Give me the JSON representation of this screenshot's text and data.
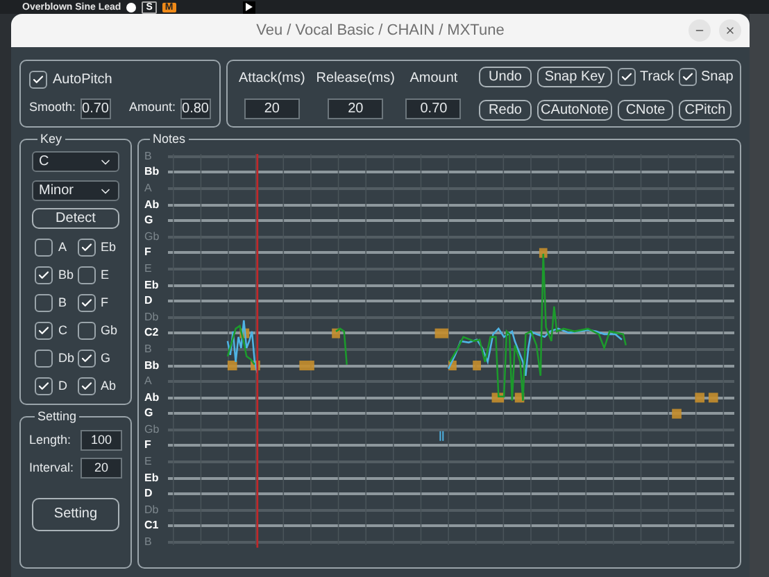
{
  "background_app": {
    "track_name": "Overblown Sine Lead",
    "buttons": [
      {
        "label": "S",
        "on": false
      },
      {
        "label": "M",
        "on": true
      }
    ]
  },
  "window": {
    "title": "Veu / Vocal Basic / CHAIN / MXTune"
  },
  "autopitch": {
    "label": "AutoPitch",
    "checked": true,
    "fields": [
      {
        "label": "Smooth:",
        "value": "0.70"
      },
      {
        "label": "Amount:",
        "value": "0.80"
      }
    ]
  },
  "envelope": [
    {
      "label": "Attack(ms)",
      "value": "20"
    },
    {
      "label": "Release(ms)",
      "value": "20"
    },
    {
      "label": "Amount",
      "value": "0.70"
    }
  ],
  "actions": [
    {
      "kind": "button",
      "label": "Undo"
    },
    {
      "kind": "button",
      "label": "Snap Key"
    },
    {
      "kind": "checkbox",
      "label": "Track",
      "checked": true
    },
    {
      "kind": "checkbox",
      "label": "Snap",
      "checked": true
    },
    {
      "kind": "button",
      "label": "Redo"
    },
    {
      "kind": "button",
      "label": "CAutoNote"
    },
    {
      "kind": "button",
      "label": "CNote"
    },
    {
      "kind": "button",
      "label": "CPitch"
    }
  ],
  "key": {
    "title": "Key",
    "root": "C",
    "scale": "Minor",
    "detect": "Detect",
    "notes": [
      {
        "label": "A",
        "checked": false
      },
      {
        "label": "Eb",
        "checked": true
      },
      {
        "label": "Bb",
        "checked": true
      },
      {
        "label": "E",
        "checked": false
      },
      {
        "label": "B",
        "checked": false
      },
      {
        "label": "F",
        "checked": true
      },
      {
        "label": "C",
        "checked": true
      },
      {
        "label": "Gb",
        "checked": false
      },
      {
        "label": "Db",
        "checked": false
      },
      {
        "label": "G",
        "checked": true
      },
      {
        "label": "D",
        "checked": true
      },
      {
        "label": "Ab",
        "checked": true
      }
    ]
  },
  "setting": {
    "title": "Setting",
    "fields": [
      {
        "label": "Length:",
        "value": "100"
      },
      {
        "label": "Interval:",
        "value": "20"
      }
    ],
    "button": "Setting"
  },
  "notes": {
    "title": "Notes",
    "rows": [
      {
        "label": "B",
        "in_key": false
      },
      {
        "label": "Bb",
        "in_key": true
      },
      {
        "label": "A",
        "in_key": false
      },
      {
        "label": "Ab",
        "in_key": true
      },
      {
        "label": "G",
        "in_key": true
      },
      {
        "label": "Gb",
        "in_key": false
      },
      {
        "label": "F",
        "in_key": true
      },
      {
        "label": "E",
        "in_key": false
      },
      {
        "label": "Eb",
        "in_key": true
      },
      {
        "label": "D",
        "in_key": true
      },
      {
        "label": "Db",
        "in_key": false
      },
      {
        "label": "C2",
        "in_key": true
      },
      {
        "label": "B",
        "in_key": false
      },
      {
        "label": "Bb",
        "in_key": true
      },
      {
        "label": "A",
        "in_key": false
      },
      {
        "label": "Ab",
        "in_key": true
      },
      {
        "label": "G",
        "in_key": true
      },
      {
        "label": "Gb",
        "in_key": false
      },
      {
        "label": "F",
        "in_key": true
      },
      {
        "label": "E",
        "in_key": false
      },
      {
        "label": "Eb",
        "in_key": true
      },
      {
        "label": "D",
        "in_key": true
      },
      {
        "label": "Db",
        "in_key": false
      },
      {
        "label": "C1",
        "in_key": true
      },
      {
        "label": "B",
        "in_key": false
      }
    ]
  }
}
